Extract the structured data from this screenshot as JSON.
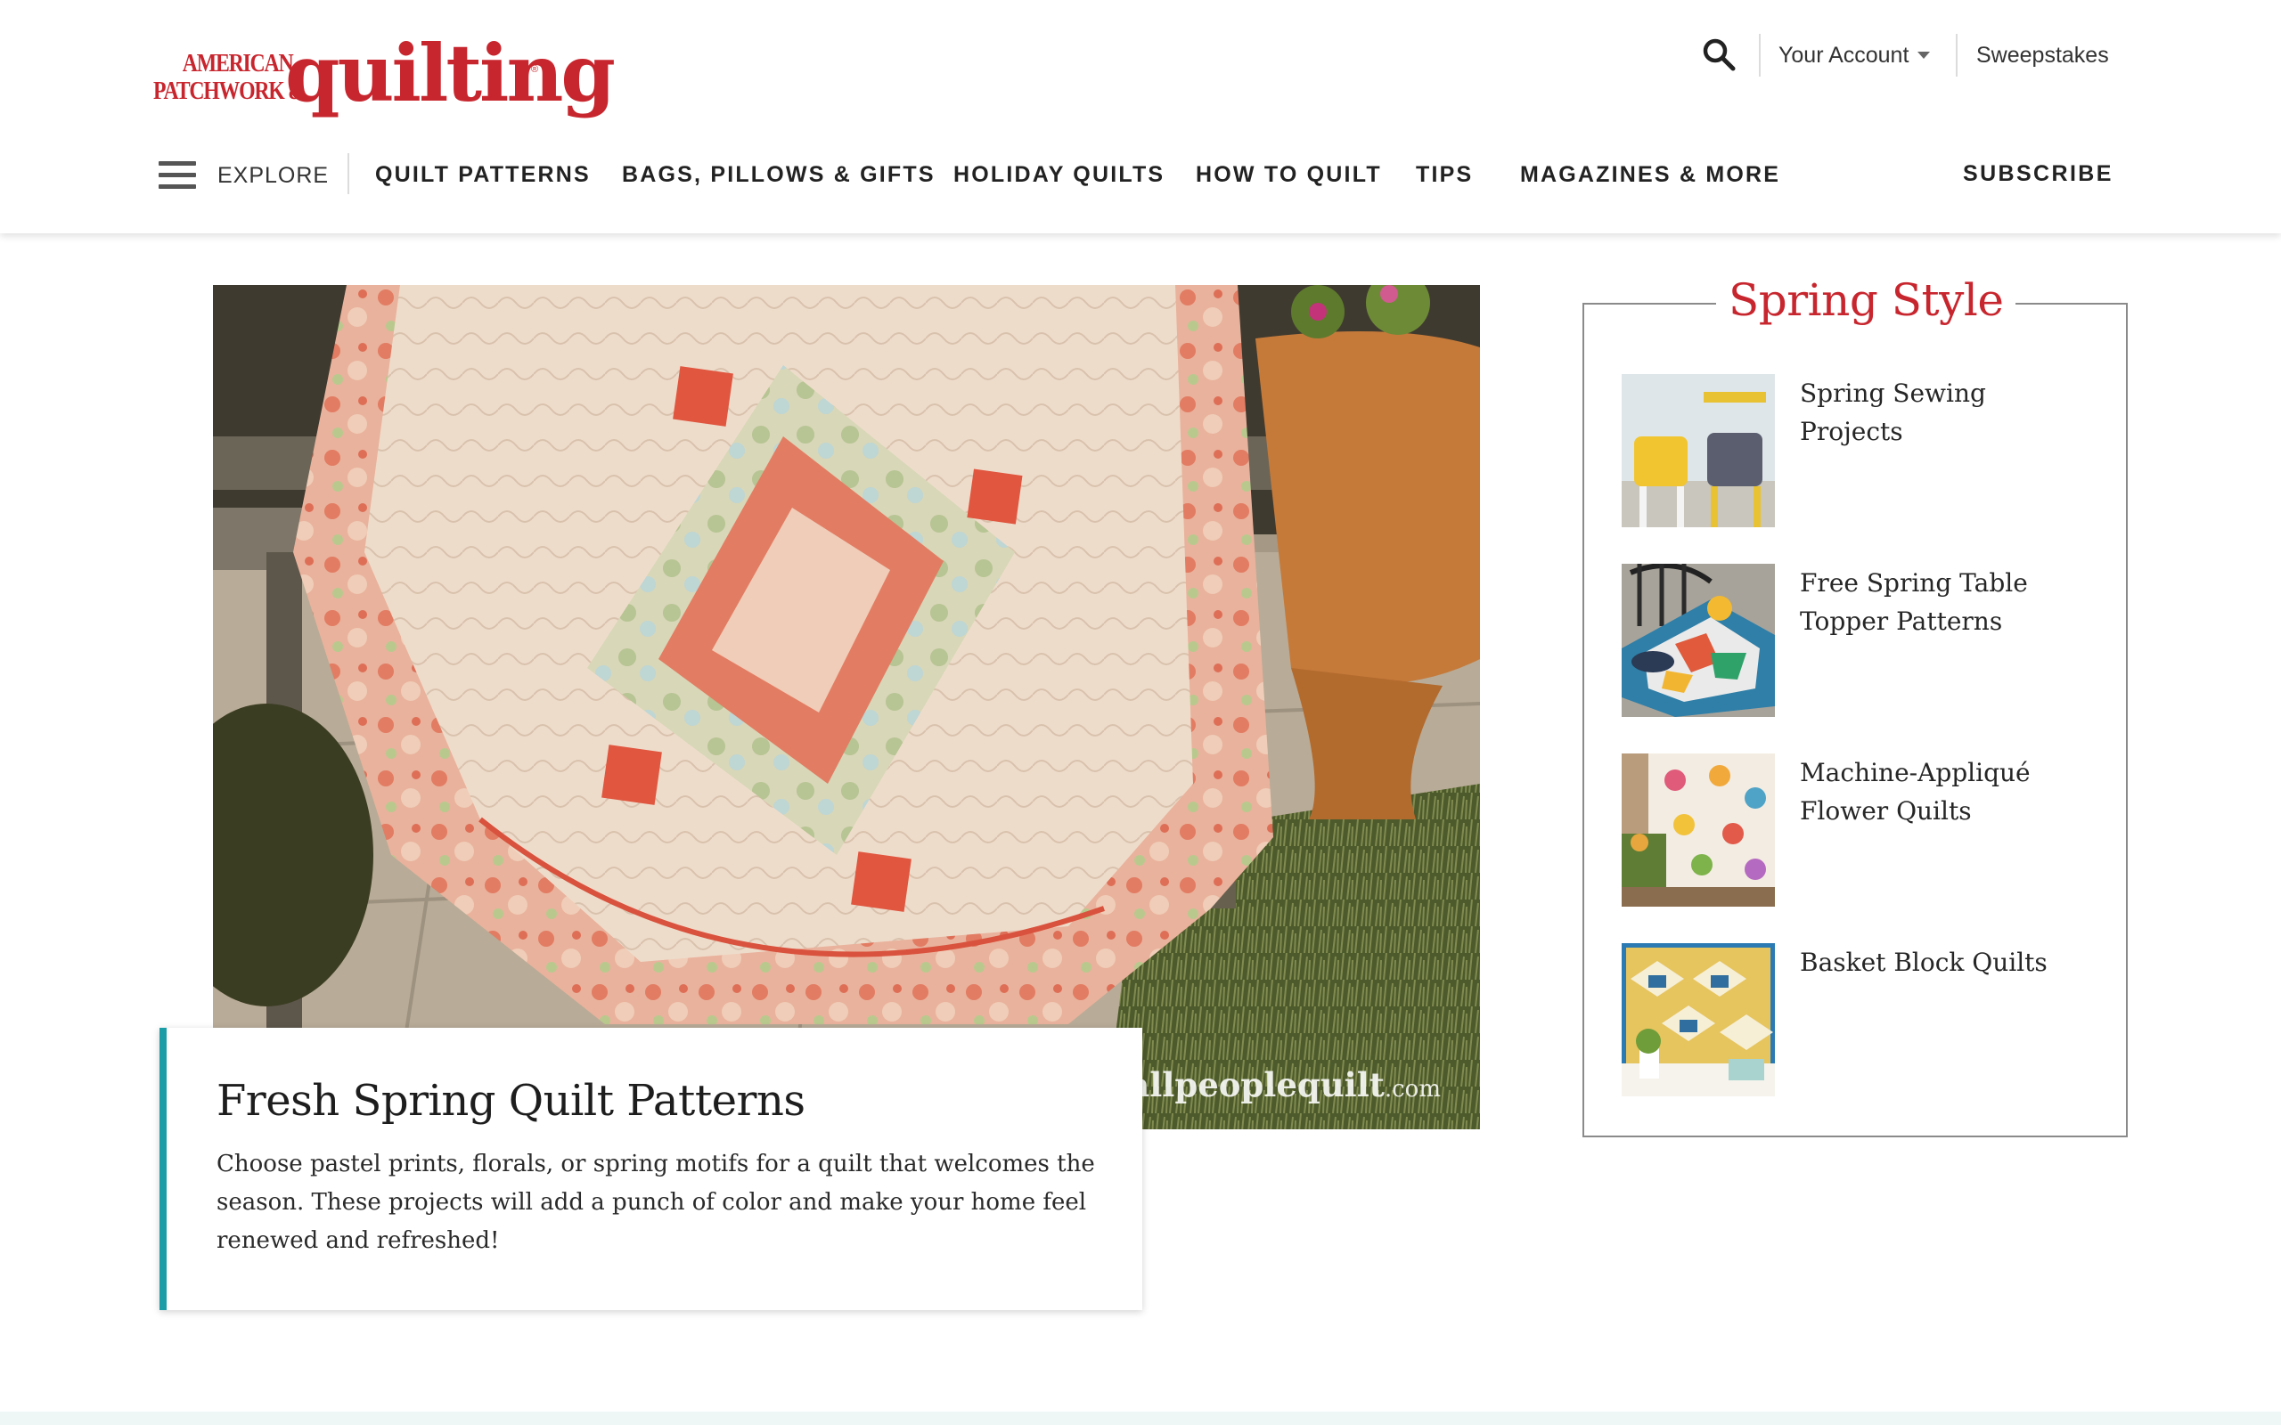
{
  "brand": {
    "line1": "AMERICAN",
    "line2": "PATCHWORK &",
    "wordmark": "quilting",
    "reg": "®",
    "color": "#c8262e"
  },
  "utility": {
    "search_icon": "search-icon",
    "account_label": "Your Account",
    "sweepstakes_label": "Sweepstakes"
  },
  "nav": {
    "explore_label": "EXPLORE",
    "items": [
      {
        "label": "QUILT PATTERNS"
      },
      {
        "label": "BAGS, PILLOWS & GIFTS"
      },
      {
        "label": "HOLIDAY QUILTS"
      },
      {
        "label": "HOW TO QUILT"
      },
      {
        "label": "TIPS"
      },
      {
        "label": "MAGAZINES & MORE"
      }
    ],
    "subscribe_label": "SUBSCRIBE"
  },
  "hero": {
    "watermark": "allpeoplequilt",
    "watermark_suffix": ".com",
    "title": "Fresh Spring Quilt Patterns",
    "description": "Choose pastel prints, florals, or spring motifs for a quilt that welcomes the season. These projects will add a punch of color and make your home feel renewed and refreshed!",
    "accent_color": "#1a9da6"
  },
  "sidebar": {
    "title": "Spring Style",
    "items": [
      {
        "label": "Spring Sewing Projects"
      },
      {
        "label": "Free Spring Table Topper Patterns"
      },
      {
        "label": "Machine-Appliqué Flower Quilts"
      },
      {
        "label": "Basket Block Quilts"
      }
    ]
  }
}
